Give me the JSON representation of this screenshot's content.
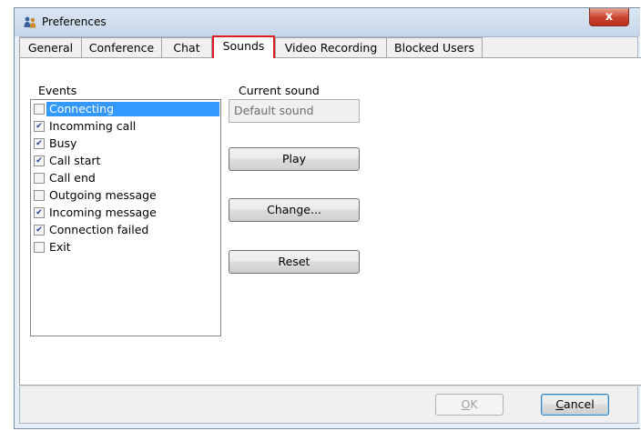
{
  "window": {
    "title": "Preferences",
    "close_glyph": "x"
  },
  "tabs": [
    {
      "label": "General",
      "active": false
    },
    {
      "label": "Conference",
      "active": false
    },
    {
      "label": "Chat",
      "active": false
    },
    {
      "label": "Sounds",
      "active": true
    },
    {
      "label": "Video Recording",
      "active": false
    },
    {
      "label": "Blocked Users",
      "active": false
    }
  ],
  "events": {
    "label": "Events",
    "items": [
      {
        "label": "Connecting",
        "checked": false,
        "selected": true
      },
      {
        "label": "Incomming call",
        "checked": true,
        "selected": false
      },
      {
        "label": "Busy",
        "checked": true,
        "selected": false
      },
      {
        "label": "Call start",
        "checked": true,
        "selected": false
      },
      {
        "label": "Call end",
        "checked": false,
        "selected": false
      },
      {
        "label": "Outgoing message",
        "checked": false,
        "selected": false
      },
      {
        "label": "Incoming message",
        "checked": true,
        "selected": false
      },
      {
        "label": "Connection failed",
        "checked": true,
        "selected": false
      },
      {
        "label": "Exit",
        "checked": false,
        "selected": false
      }
    ]
  },
  "sound": {
    "label": "Current sound",
    "value": "Default sound",
    "play_label": "Play",
    "change_label": "Change...",
    "reset_label": "Reset"
  },
  "footer": {
    "ok_label": "OK",
    "ok_mnemonic": "O",
    "ok_rest": "K",
    "cancel_label": "Cancel",
    "cancel_mnemonic": "C",
    "cancel_rest": "ancel"
  },
  "colors": {
    "selection": "#3399ff",
    "active_tab_highlight": "#e11b22",
    "close_button": "#c9442d"
  }
}
